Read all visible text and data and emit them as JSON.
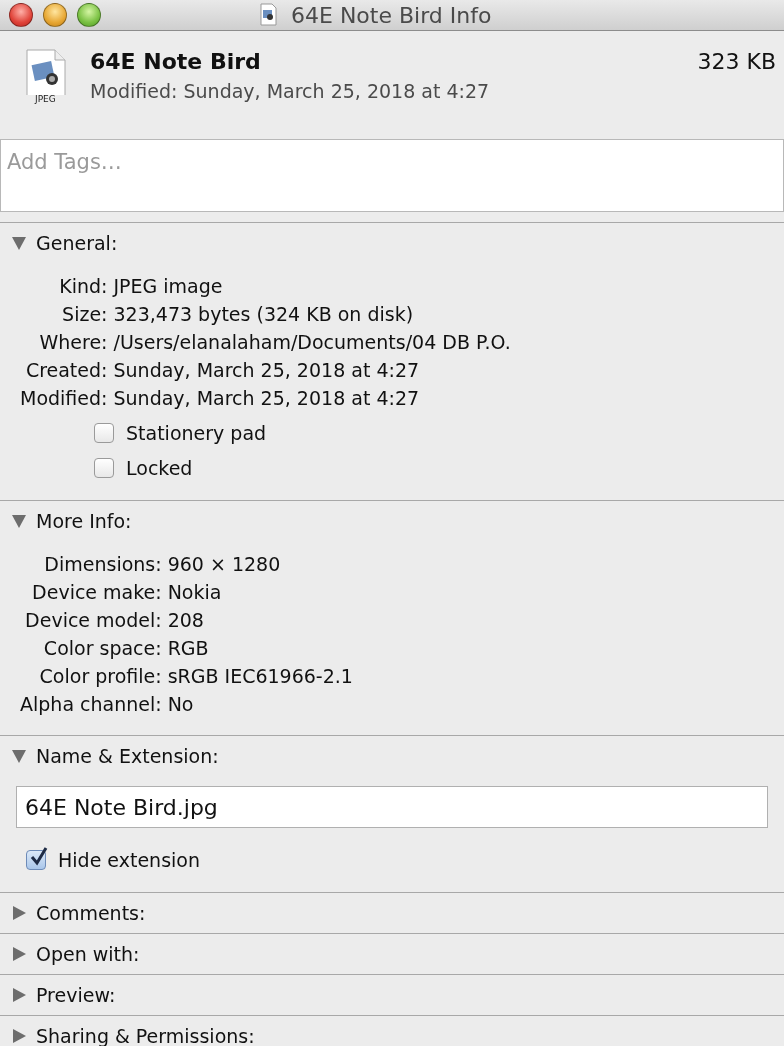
{
  "window": {
    "title": "64E Note Bird Info"
  },
  "header": {
    "name": "64E Note Bird",
    "size": "323 KB",
    "modified": "Modified: Sunday, March 25, 2018 at 4:27",
    "icon_label": "JPEG"
  },
  "tags": {
    "placeholder": "Add Tags…"
  },
  "sections": [
    {
      "title": "General:",
      "expanded": true,
      "kind": "info",
      "rows": [
        {
          "label": "Kind:",
          "value": "JPEG image"
        },
        {
          "label": "Size:",
          "value": "323,473 bytes (324 KB on disk)"
        },
        {
          "label": "Where:",
          "value": "/Users/elanalaham/Documents/04 DB P.O."
        },
        {
          "label": "Created:",
          "value": "Sunday, March 25, 2018 at 4:27"
        },
        {
          "label": "Modified:",
          "value": "Sunday, March 25, 2018 at 4:27"
        }
      ],
      "checkboxes": [
        {
          "label": "Stationery pad",
          "checked": false
        },
        {
          "label": "Locked",
          "checked": false
        }
      ]
    },
    {
      "title": "More Info:",
      "expanded": true,
      "kind": "info",
      "rows": [
        {
          "label": "Dimensions:",
          "value": "960 × 1280"
        },
        {
          "label": "Device make:",
          "value": "Nokia"
        },
        {
          "label": "Device model:",
          "value": "208"
        },
        {
          "label": "Color space:",
          "value": "RGB"
        },
        {
          "label": "Color profile:",
          "value": "sRGB IEC61966-2.1"
        },
        {
          "label": "Alpha channel:",
          "value": "No"
        }
      ]
    },
    {
      "title": "Name & Extension:",
      "expanded": true,
      "kind": "name",
      "field": {
        "value": "64E Note Bird.jpg"
      },
      "checkboxes": [
        {
          "label": "Hide extension",
          "checked": true
        }
      ]
    },
    {
      "title": "Comments:",
      "expanded": false
    },
    {
      "title": "Open with:",
      "expanded": false
    },
    {
      "title": "Preview:",
      "expanded": false
    },
    {
      "title": "Sharing & Permissions:",
      "expanded": false
    }
  ]
}
